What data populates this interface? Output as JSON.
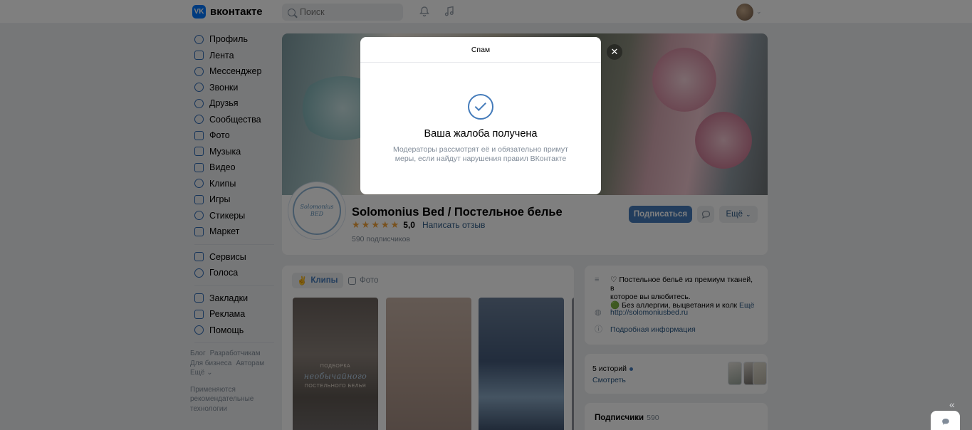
{
  "header": {
    "logo_mark": "VK",
    "logo_text": "вконтакте",
    "search_placeholder": "Поиск",
    "bell_icon": "bell-icon",
    "music_icon": "music-icon"
  },
  "sidebar": {
    "items": [
      {
        "label": "Профиль",
        "icon": "user-icon"
      },
      {
        "label": "Лента",
        "icon": "newsfeed-icon"
      },
      {
        "label": "Мессенджер",
        "icon": "message-icon"
      },
      {
        "label": "Звонки",
        "icon": "phone-icon"
      },
      {
        "label": "Друзья",
        "icon": "friends-icon"
      },
      {
        "label": "Сообщества",
        "icon": "communities-icon"
      },
      {
        "label": "Фото",
        "icon": "photo-icon"
      },
      {
        "label": "Музыка",
        "icon": "music-icon"
      },
      {
        "label": "Видео",
        "icon": "video-icon"
      },
      {
        "label": "Клипы",
        "icon": "clips-icon"
      },
      {
        "label": "Игры",
        "icon": "games-icon"
      },
      {
        "label": "Стикеры",
        "icon": "stickers-icon"
      },
      {
        "label": "Маркет",
        "icon": "market-icon"
      }
    ],
    "items2": [
      {
        "label": "Сервисы",
        "icon": "services-icon"
      },
      {
        "label": "Голоса",
        "icon": "votes-icon"
      }
    ],
    "items3": [
      {
        "label": "Закладки",
        "icon": "bookmark-icon"
      },
      {
        "label": "Реклама",
        "icon": "ads-icon"
      },
      {
        "label": "Помощь",
        "icon": "help-icon"
      }
    ],
    "footer": {
      "blog": "Блог",
      "developers": "Разработчикам",
      "business": "Для бизнеса",
      "authors": "Авторам",
      "more": "Ещё ⌄",
      "recommend": "Применяются рекомендательные технологии"
    }
  },
  "profile": {
    "name": "Solomonius Bed / Постельное белье",
    "avatar_text": "Solomonius BED",
    "rating_stars": 5,
    "rating_value": "5,0",
    "review_link": "Написать отзыв",
    "subscribers": "590 подписчиков",
    "subscribe_button": "Подписаться",
    "more_button": "Ещё"
  },
  "tabs": {
    "clips": "Клипы",
    "photo": "Фото"
  },
  "clips": [
    {
      "line1": "ПОДБОРКА",
      "line2": "необычайного",
      "line3": "ПОСТЕЛЬНОГО БЕЛЬЯ"
    },
    {
      "line1": "",
      "line2": "",
      "line3": ""
    },
    {
      "line1": "",
      "line2": "",
      "line3": ""
    }
  ],
  "info": {
    "description_line1": "♡ Постельное бельё из премиум тканей, в",
    "description_line2": "которое вы влюбитесь.",
    "description_line3": "🟢 Без аллергии, выцветания и колк",
    "description_more": "Ещё",
    "website": "http://solomoniusbed.ru",
    "details": "Подробная информация"
  },
  "stories": {
    "count": "5 историй",
    "view": "Смотреть"
  },
  "subscribers_block": {
    "title": "Подписчики",
    "count": "590"
  },
  "modal": {
    "title": "Спам",
    "heading": "Ваша жалоба получена",
    "description": "Модераторы рассмотрят её и обязательно примут меры, если найдут нарушения правил ВКонтакте",
    "close": "✕"
  },
  "colors": {
    "accent": "#447bba",
    "link": "#2a5885",
    "background": "#edeef0",
    "overlay": "rgba(0,0,0,0.5)",
    "star": "#f2a33a"
  }
}
